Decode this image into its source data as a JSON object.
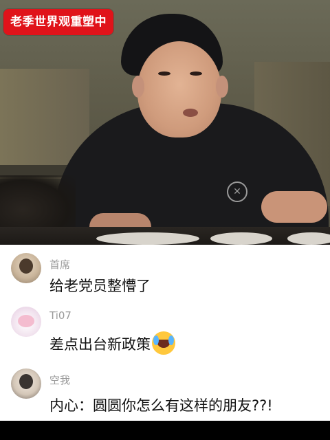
{
  "video": {
    "overlay_badge": "老季世界观重塑中"
  },
  "comments": [
    {
      "avatar": "avatar-woman-photo",
      "username": "首席",
      "text": "给老党员整懵了"
    },
    {
      "avatar": "avatar-cartoon-cat",
      "username": "Ti07",
      "text": "差点出台新政策",
      "emoji": "rolling-laughing-crying-emoji"
    },
    {
      "avatar": "avatar-man-photo",
      "username": "空我",
      "text": "内心：圆圆你怎么有这样的朋友??!"
    }
  ]
}
